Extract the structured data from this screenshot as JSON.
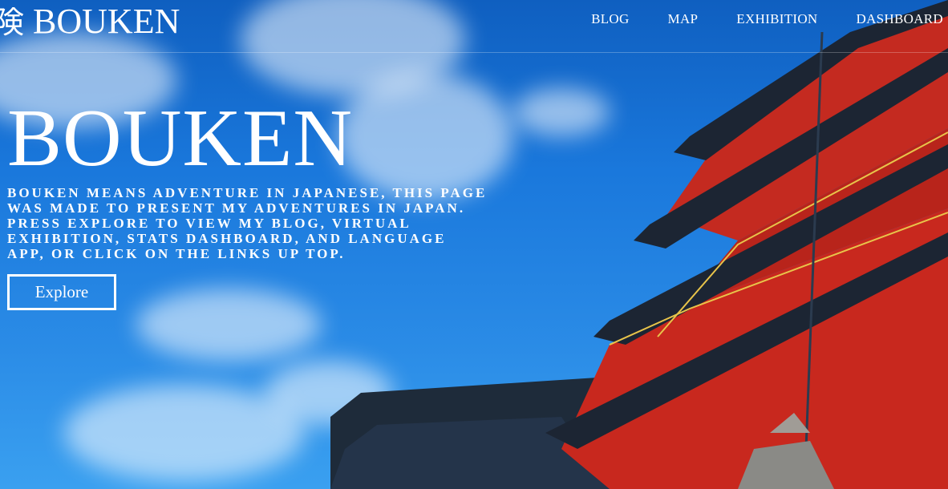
{
  "header": {
    "logo_kanji": "険",
    "logo_text": "BOUKEN",
    "nav": [
      {
        "label": "BLOG"
      },
      {
        "label": "MAP"
      },
      {
        "label": "EXHIBITION"
      },
      {
        "label": "DASHBOARD"
      }
    ]
  },
  "hero": {
    "title": "BOUKEN",
    "description": "Bouken means adventure in Japanese, this page was made to present my adventures in Japan. Press explore to view my blog, virtual exhibition, stats dashboard, and language app, or click on the links up top.",
    "explore_label": "Explore"
  },
  "colors": {
    "sky": "#1a78dc",
    "pagoda_red": "#c8281e",
    "roof_dark": "#1e2b3a",
    "text": "#ffffff"
  }
}
